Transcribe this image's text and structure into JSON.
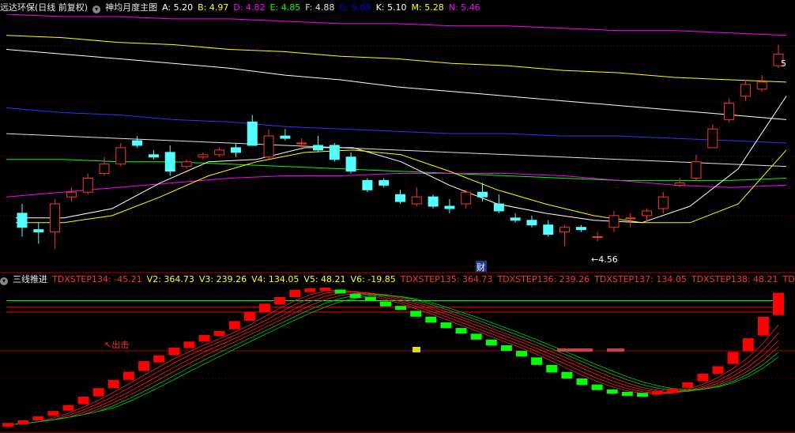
{
  "top_bar": {
    "symbol": "远达环保(日线 前复权)",
    "indicator": "神均月度主图",
    "values": [
      {
        "label": "A:",
        "value": "5.20",
        "color": "#ffffff"
      },
      {
        "label": "B:",
        "value": "4.97",
        "color": "#ffff00"
      },
      {
        "label": "D:",
        "value": "4.82",
        "color": "#ff00ff"
      },
      {
        "label": "E:",
        "value": "4.85",
        "color": "#00ff00"
      },
      {
        "label": "F:",
        "value": "4.88",
        "color": "#e0e0e0"
      },
      {
        "label": "G:",
        "value": "5.00",
        "color": "#0000ff"
      },
      {
        "label": "K:",
        "value": "5.10",
        "color": "#ffffff"
      },
      {
        "label": "M:",
        "value": "5.28",
        "color": "#ffff00"
      },
      {
        "label": "N:",
        "value": "5.46",
        "color": "#ff00ff"
      }
    ]
  },
  "bottom_bar": {
    "indicator": "三线推进",
    "values": [
      {
        "text": "TDXSTEP134: -45.21",
        "color": "#ff3030"
      },
      {
        "text": "V2: 364.73",
        "color": "#ffff00"
      },
      {
        "text": "V3: 239.26",
        "color": "#ffff00"
      },
      {
        "text": "V4: 134.05",
        "color": "#ffff00"
      },
      {
        "text": "V5: 48.21",
        "color": "#ffff00"
      },
      {
        "text": "V6: -19.85",
        "color": "#ffff00"
      },
      {
        "text": "TDXSTEP135: 364.73",
        "color": "#ff3030"
      },
      {
        "text": "TDXSTEP136: 239.26",
        "color": "#ff3030"
      },
      {
        "text": "TDXSTEP137: 134.05",
        "color": "#ff3030"
      },
      {
        "text": "TDXSTEP138: 48.21",
        "color": "#ff3030"
      },
      {
        "text": "TDX",
        "color": "#ff3030"
      }
    ]
  },
  "annotations": {
    "low_label": "4.56",
    "high_label": "5",
    "cai_label": "财",
    "exit_label": "出击"
  },
  "chart_data": [
    {
      "type": "candlestick",
      "title": "神均月度主图",
      "ylim": [
        4.45,
        5.55
      ],
      "candles": [
        [
          4.7,
          4.64,
          4.74,
          4.6
        ],
        [
          4.63,
          4.62,
          4.66,
          4.57
        ],
        [
          4.62,
          4.74,
          4.76,
          4.55
        ],
        [
          4.77,
          4.79,
          4.81,
          4.75
        ],
        [
          4.79,
          4.85,
          4.87,
          4.78
        ],
        [
          4.87,
          4.91,
          4.94,
          4.86
        ],
        [
          4.91,
          4.98,
          5.0,
          4.9
        ],
        [
          5.01,
          4.99,
          5.03,
          4.98
        ],
        [
          4.95,
          4.94,
          4.97,
          4.93
        ],
        [
          4.96,
          4.88,
          4.99,
          4.86
        ],
        [
          4.9,
          4.92,
          4.93,
          4.89
        ],
        [
          4.94,
          4.95,
          4.96,
          4.93
        ],
        [
          4.95,
          4.97,
          4.98,
          4.94
        ],
        [
          4.98,
          4.96,
          5.0,
          4.94
        ],
        [
          5.09,
          4.99,
          5.12,
          4.99
        ],
        [
          4.94,
          5.03,
          5.06,
          4.93
        ],
        [
          5.03,
          5.02,
          5.06,
          5.01
        ],
        [
          5.0,
          5.0,
          5.02,
          4.97
        ],
        [
          4.99,
          4.97,
          5.03,
          4.96
        ],
        [
          4.99,
          4.93,
          5.0,
          4.92
        ],
        [
          4.94,
          4.88,
          4.96,
          4.87
        ],
        [
          4.84,
          4.8,
          4.85,
          4.79
        ],
        [
          4.84,
          4.82,
          4.85,
          4.81
        ],
        [
          4.78,
          4.75,
          4.8,
          4.74
        ],
        [
          4.74,
          4.77,
          4.81,
          4.73
        ],
        [
          4.77,
          4.73,
          4.78,
          4.72
        ],
        [
          4.73,
          4.72,
          4.76,
          4.7
        ],
        [
          4.74,
          4.79,
          4.8,
          4.72
        ],
        [
          4.79,
          4.77,
          4.83,
          4.75
        ],
        [
          4.74,
          4.71,
          4.78,
          4.7
        ],
        [
          4.68,
          4.67,
          4.7,
          4.66
        ],
        [
          4.67,
          4.65,
          4.69,
          4.64
        ],
        [
          4.65,
          4.61,
          4.67,
          4.6
        ],
        [
          4.62,
          4.64,
          4.65,
          4.56
        ],
        [
          4.64,
          4.63,
          4.65,
          4.62
        ],
        [
          4.6,
          4.6,
          4.62,
          4.58
        ],
        [
          4.64,
          4.69,
          4.71,
          4.62
        ],
        [
          4.68,
          4.68,
          4.7,
          4.64
        ],
        [
          4.69,
          4.71,
          4.72,
          4.66
        ],
        [
          4.72,
          4.77,
          4.79,
          4.7
        ],
        [
          4.82,
          4.83,
          4.85,
          4.81
        ],
        [
          4.85,
          4.92,
          4.95,
          4.84
        ],
        [
          4.98,
          5.06,
          5.08,
          4.98
        ],
        [
          5.1,
          5.17,
          5.19,
          5.09
        ],
        [
          5.2,
          5.25,
          5.27,
          5.18
        ],
        [
          5.23,
          5.26,
          5.29,
          5.22
        ],
        [
          5.33,
          5.38,
          5.42,
          5.32
        ]
      ],
      "lines": [
        {
          "key": "K",
          "color": "#ffffff",
          "values": [
            5.4,
            5.38,
            5.36,
            5.34,
            5.32,
            5.29,
            5.27,
            5.24,
            5.22,
            5.2,
            5.18,
            5.16,
            5.14,
            5.12,
            5.1
          ]
        },
        {
          "key": "M",
          "color": "#ffff00",
          "values": [
            5.46,
            5.45,
            5.43,
            5.42,
            5.4,
            5.39,
            5.37,
            5.36,
            5.34,
            5.33,
            5.31,
            5.3,
            5.28,
            5.27,
            5.26
          ]
        },
        {
          "key": "N",
          "color": "#ff00ff",
          "values": [
            5.55,
            5.54,
            5.54,
            5.53,
            5.53,
            5.52,
            5.51,
            5.51,
            5.5,
            5.5,
            5.49,
            5.48,
            5.48,
            5.47,
            5.46
          ]
        },
        {
          "key": "G",
          "color": "#3030ff",
          "values": [
            5.15,
            5.13,
            5.12,
            5.1,
            5.09,
            5.07,
            5.06,
            5.05,
            5.04,
            5.04,
            5.03,
            5.03,
            5.02,
            5.01,
            5.0
          ]
        },
        {
          "key": "F",
          "color": "#e0e0e0",
          "values": [
            5.04,
            5.03,
            5.02,
            5.01,
            5.0,
            4.99,
            4.98,
            4.97,
            4.96,
            4.95,
            4.94,
            4.93,
            4.92,
            4.91,
            4.9
          ]
        },
        {
          "key": "E",
          "color": "#00ff00",
          "values": [
            4.93,
            4.93,
            4.92,
            4.92,
            4.91,
            4.9,
            4.89,
            4.88,
            4.87,
            4.86,
            4.85,
            4.84,
            4.84,
            4.84,
            4.85
          ]
        },
        {
          "key": "D",
          "color": "#ff00ff",
          "values": [
            4.77,
            4.79,
            4.81,
            4.83,
            4.85,
            4.86,
            4.86,
            4.87,
            4.87,
            4.87,
            4.86,
            4.84,
            4.82,
            4.81,
            4.82
          ]
        },
        {
          "key": "A",
          "color": "#ffffff",
          "values": [
            4.68,
            4.68,
            4.72,
            4.83,
            4.92,
            4.93,
            4.98,
            4.98,
            4.92,
            4.82,
            4.74,
            4.7,
            4.67,
            4.66,
            4.73,
            4.89,
            5.2
          ]
        },
        {
          "key": "B",
          "color": "#ffff00",
          "values": [
            4.66,
            4.66,
            4.69,
            4.77,
            4.86,
            4.92,
            4.96,
            4.97,
            4.95,
            4.88,
            4.8,
            4.74,
            4.69,
            4.66,
            4.66,
            4.74,
            4.97
          ]
        }
      ]
    },
    {
      "type": "bar",
      "title": "三线推进",
      "ylim": [
        -60,
        380
      ],
      "values": [
        -40,
        -32,
        -20,
        -5,
        12,
        35,
        60,
        85,
        110,
        140,
        162,
        185,
        205,
        225,
        240,
        265,
        292,
        318,
        340,
        362,
        372,
        376,
        368,
        355,
        345,
        330,
        318,
        300,
        282,
        265,
        248,
        230,
        212,
        195,
        178,
        155,
        132,
        112,
        92,
        75,
        62,
        55,
        52,
        58,
        65,
        82,
        105,
        128,
        165,
        205,
        262,
        330
      ],
      "colors_up": "#ff0000",
      "colors_down": "#00ff00",
      "ref_lines": [
        {
          "value": 340,
          "color": "#00ff00"
        },
        {
          "value": 320,
          "color": "#ff0000"
        },
        {
          "value": 305,
          "color": "#ff0000"
        }
      ]
    }
  ]
}
